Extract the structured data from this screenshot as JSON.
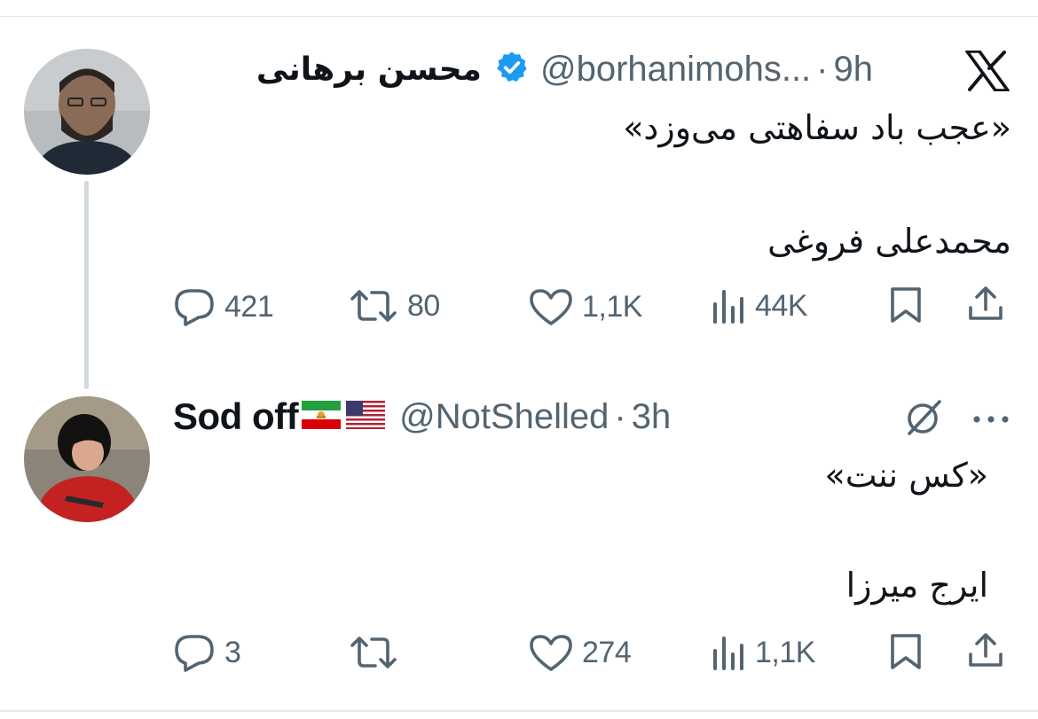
{
  "tweets": [
    {
      "display_name": "محسن برهانی",
      "verified": true,
      "handle": "@borhanimohs...",
      "separator": "·",
      "time": "9h",
      "lines": [
        "«عجب باد سفاهتی می‌وزد»",
        "",
        "محمدعلی فروغی"
      ],
      "stats": {
        "replies": "421",
        "reposts": "80",
        "likes": "1,1K",
        "views": "44K"
      }
    },
    {
      "display_name": "Sod off",
      "flags": [
        "iran-lion-sun-flag",
        "us-flag"
      ],
      "handle": "@NotShelled",
      "separator": "·",
      "time": "3h",
      "lines": [
        "«کس ننت»",
        "",
        "ایرج میرزا"
      ],
      "stats": {
        "replies": "3",
        "reposts": "",
        "likes": "274",
        "views": "1,1K"
      }
    }
  ],
  "icons": {
    "logo": "x-logo-icon",
    "verified": "verified-badge-icon",
    "grok": "grok-icon",
    "more": "more-dots-icon",
    "reply": "reply-icon",
    "repost": "repost-icon",
    "like": "like-icon",
    "views": "views-icon",
    "bookmark": "bookmark-icon",
    "share": "share-icon"
  },
  "colors": {
    "text": "#0f1419",
    "secondary": "#536471",
    "verified": "#1d9bf0",
    "thread_line": "#cfd9de"
  }
}
